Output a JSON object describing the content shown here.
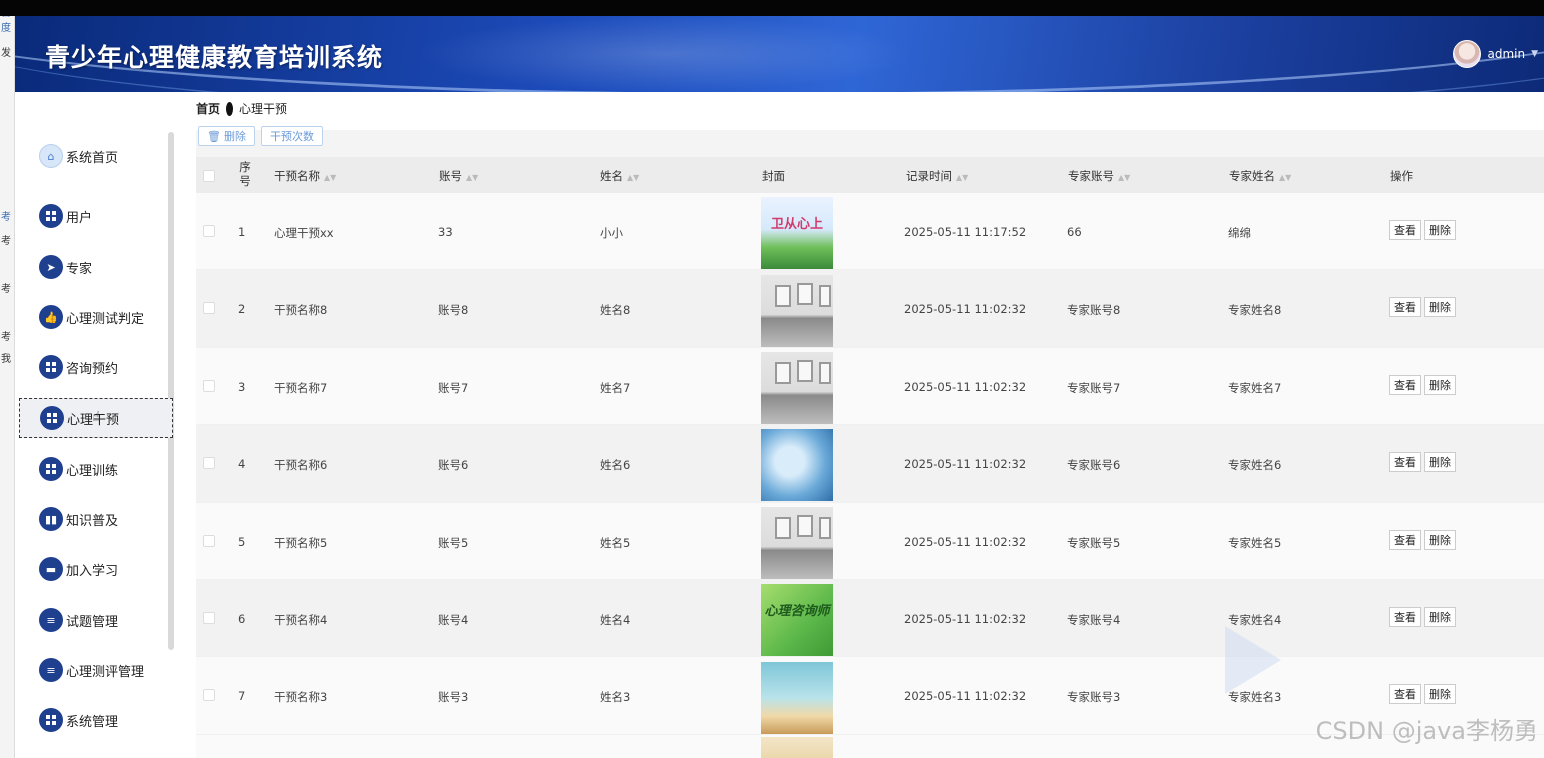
{
  "side_strip_chars": [
    "百度",
    "发",
    "考",
    "考",
    "考",
    "考",
    "我"
  ],
  "header": {
    "title": "青少年心理健康教育培训系统",
    "username": "admin"
  },
  "breadcrumb": {
    "home": "首页",
    "current": "心理干预"
  },
  "sidebar": {
    "items": [
      {
        "label": "系统首页",
        "icon": "home-icon"
      },
      {
        "label": "用户",
        "icon": "grid-icon"
      },
      {
        "label": "专家",
        "icon": "send-icon"
      },
      {
        "label": "心理测试判定",
        "icon": "thumb-icon"
      },
      {
        "label": "咨询预约",
        "icon": "grid-icon"
      },
      {
        "label": "心理干预",
        "icon": "grid-icon",
        "active": true
      },
      {
        "label": "心理训练",
        "icon": "grid-icon"
      },
      {
        "label": "知识普及",
        "icon": "bar-chart-icon"
      },
      {
        "label": "加入学习",
        "icon": "ticket-icon"
      },
      {
        "label": "试题管理",
        "icon": "list-icon"
      },
      {
        "label": "心理测评管理",
        "icon": "list-icon"
      },
      {
        "label": "系统管理",
        "icon": "grid-icon"
      }
    ]
  },
  "toolbar": {
    "delete_label": "删除",
    "count_label": "干预次数"
  },
  "table": {
    "headers": {
      "index": "序号",
      "name": "干预名称",
      "account": "账号",
      "realname": "姓名",
      "cover": "封面",
      "time": "记录时间",
      "expert_account": "专家账号",
      "expert_name": "专家姓名",
      "ops": "操作"
    },
    "view_label": "查看",
    "del_label": "删除",
    "rows": [
      {
        "index": "1",
        "name": "心理干预xx",
        "account": "33",
        "realname": "小小",
        "time": "2025-05-11 11:17:52",
        "expert_account": "66",
        "expert_name": "绵绵",
        "cover": "banner",
        "cover_text": "卫从心上"
      },
      {
        "index": "2",
        "name": "干预名称8",
        "account": "账号8",
        "realname": "姓名8",
        "time": "2025-05-11 11:02:32",
        "expert_account": "专家账号8",
        "expert_name": "专家姓名8",
        "cover": "room"
      },
      {
        "index": "3",
        "name": "干预名称7",
        "account": "账号7",
        "realname": "姓名7",
        "time": "2025-05-11 11:02:32",
        "expert_account": "专家账号7",
        "expert_name": "专家姓名7",
        "cover": "room"
      },
      {
        "index": "4",
        "name": "干预名称6",
        "account": "账号6",
        "realname": "姓名6",
        "time": "2025-05-11 11:02:32",
        "expert_account": "专家账号6",
        "expert_name": "专家姓名6",
        "cover": "hands"
      },
      {
        "index": "5",
        "name": "干预名称5",
        "account": "账号5",
        "realname": "姓名5",
        "time": "2025-05-11 11:02:32",
        "expert_account": "专家账号5",
        "expert_name": "专家姓名5",
        "cover": "room"
      },
      {
        "index": "6",
        "name": "干预名称4",
        "account": "账号4",
        "realname": "姓名4",
        "time": "2025-05-11 11:02:32",
        "expert_account": "专家账号4",
        "expert_name": "专家姓名4",
        "cover": "green",
        "cover_text": "心理咨询师"
      },
      {
        "index": "7",
        "name": "干预名称3",
        "account": "账号3",
        "realname": "姓名3",
        "time": "2025-05-11 11:02:32",
        "expert_account": "专家账号3",
        "expert_name": "专家姓名3",
        "cover": "classroom"
      }
    ]
  },
  "watermark": "CSDN @java李杨勇"
}
